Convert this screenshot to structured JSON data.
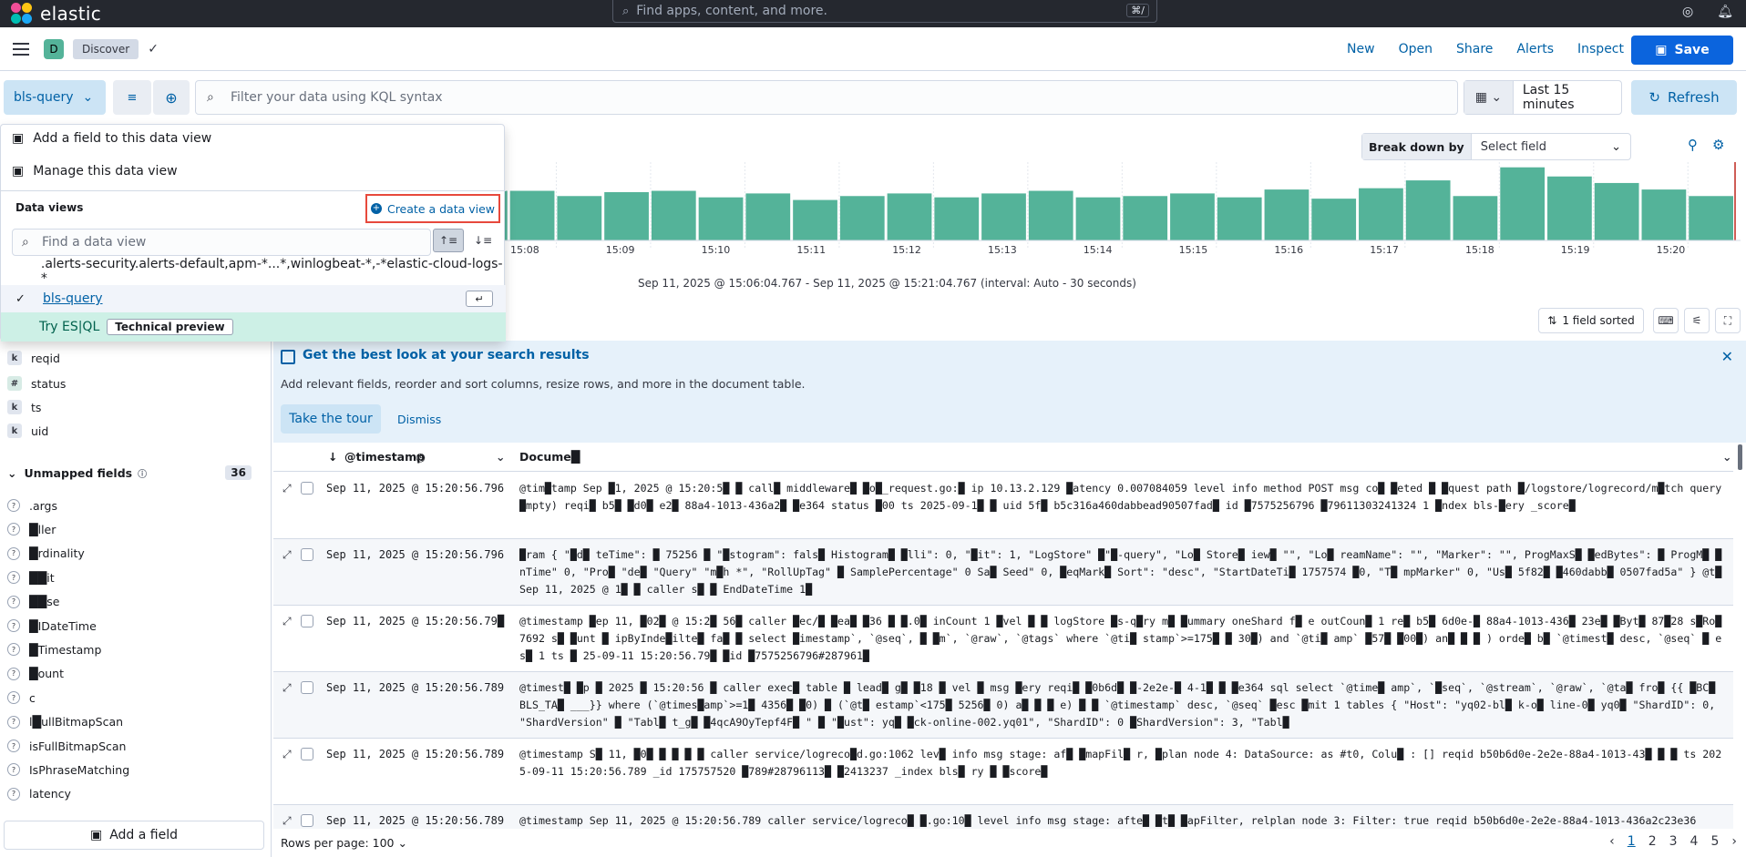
{
  "header": {
    "brand": "elastic",
    "search_placeholder": "Find apps, content, and more.",
    "search_shortcut": "⌘/",
    "icons": [
      "help-icon",
      "notifications-icon"
    ]
  },
  "app_bar": {
    "space_initial": "D",
    "breadcrumb": "Discover",
    "menu": [
      "New",
      "Open",
      "Share",
      "Alerts",
      "Inspect"
    ],
    "save_label": "Save"
  },
  "query": {
    "data_view": "bls-query",
    "placeholder": "Filter your data using KQL syntax",
    "time_range": "Last 15 minutes",
    "refresh_label": "Refresh"
  },
  "dropdown": {
    "add_field": "Add a field to this data view",
    "manage": "Manage this data view",
    "section_title": "Data views",
    "create_label": "Create a data view",
    "search_placeholder": "Find a data view",
    "options": [
      ".alerts-security.alerts-default,apm-*...*,winlogbeat-*,-*elastic-cloud-logs-*",
      "bls-query"
    ],
    "esql_label": "Try ES|QL",
    "esql_badge": "Technical preview"
  },
  "chart": {
    "breakdown_label": "Break down by",
    "breakdown_placeholder": "Select field",
    "range_text": "Sep 11, 2025 @ 15:06:04.767 - Sep 11, 2025 @ 15:21:04.767 (interval: Auto - 30 seconds)",
    "accent": "#54b399"
  },
  "chart_data": {
    "type": "bar",
    "title": "",
    "xlabel": "",
    "ylabel": "",
    "tick_labels": [
      "15:08",
      "15:09",
      "15:10",
      "15:11",
      "15:12",
      "15:13",
      "15:14",
      "15:15",
      "15:16",
      "15:17",
      "15:18",
      "15:19",
      "15:20"
    ],
    "values": [
      29,
      38,
      37,
      39,
      38,
      38,
      34,
      37,
      38,
      33,
      36,
      31,
      34,
      36,
      33,
      36,
      38,
      33,
      34,
      36,
      33,
      39,
      32,
      40,
      46,
      34,
      56,
      49,
      44,
      39,
      34
    ]
  },
  "toolbar": {
    "sorted_label": "1 field sorted"
  },
  "sidebar": {
    "fields": [
      {
        "type": "k",
        "name": "reqid"
      },
      {
        "type": "#",
        "name": "status"
      },
      {
        "type": "k",
        "name": "ts"
      },
      {
        "type": "k",
        "name": "uid"
      }
    ],
    "unmapped_title": "Unmapped fields",
    "unmapped_count": "36",
    "unmapped": [
      ".args",
      "█ller",
      "█rdinality",
      "██it",
      "██se",
      "█IDateTime",
      "█Timestamp",
      "█ount",
      "c",
      "l█ullBitmapScan",
      "isFullBitmapScan",
      "IsPhraseMatching",
      "latency"
    ],
    "add_field_label": "Add a field"
  },
  "callout": {
    "title": "Get the best look at your search results",
    "body": "Add relevant fields, reorder and sort columns, resize rows, and more in the document table.",
    "tour_label": "Take the tour",
    "dismiss_label": "Dismiss"
  },
  "grid": {
    "col_timestamp": "@timestamp",
    "col_document": "Docume█",
    "rows": [
      {
        "ts": "Sep 11, 2025 @ 15:20:56.796",
        "doc": "@tim█tamp Sep █1, 2025 @ 15:20:5█ █ call█ middleware█ █o█_request.go:█ ip 10.13.2.129 █atency 0.007084059 level info method POST msg co█ █eted █ █quest path █/logstore/logrecord/m█tch query █mpty) reqi█ b5█ █d0█ e2█ 88a4-1013-436a2█ █e364 status █00 ts 2025-09-1█ █ uid 5f█ b5c316a460dabbead90507fad█ id █7575256796 █79611303241324 1 █ndex bls-█ery _score█"
      },
      {
        "ts": "Sep 11, 2025 @ 15:20:56.796",
        "doc": "█ram { \"█d█ teTime\": █ 75256 █ \"█stogram\": fals█ Histogram█ █lli\": 0, \"█it\": 1, \"LogStore\" █\"█-query\", \"Lo█ Store█ iew█ \"\", \"Lo█ reamName\": \"\", \"Marker\": \"\", ProgMaxS█ █edBytes\": █ ProgM█ █nTime\" 0, \"Pro█ \"de█ \"Query\" \"m█h *\", \"RollUpTag\" █ SamplePercentage\" 0 Sa█ Seed\" 0, █eqMark█ Sort\": \"desc\", \"StartDateTi█ 1757574 █0, \"T█ mpMarker\" 0, \"Us█ 5f82█ █460dabb█ 0507fad5a\" } @t█ Sep 11, 2025 @ 1█ █ caller s█ █ EndDateTime 1█"
      },
      {
        "ts": "Sep 11, 2025 @ 15:20:56.79█",
        "doc": "@timestamp █ep 11, █02█ @ 15:2█ 56█ caller █ec/█ █ea█ █36 █ █.0█ inCount 1 █vel █ █ logStore █s-q█ry m█ █ummary oneShard f█ e outCoun█ 1 re█ b5█ 6d0e-█ 88a4-1013-436█ 23e█ █Byt█ 87█28 s█Ro█ 7692 s█ █unt █ ipByInde█ilte█ fa█ █ select █imestamp`, `@seq`, █ █m`, `@raw`, `@tags` where `@ti█ stamp`>=175█ █ 30█) and `@ti█ amp` █57█ █00█) an█ █ █ ) orde█ b█ `@timest█ desc, `@seq` █ es█ 1 ts █ 25-09-11 15:20:56.79█ █id █7575256796#287961█"
      },
      {
        "ts": "Sep 11, 2025 @ 15:20:56.789",
        "doc": "@timest█ █p █ 2025 █ 15:20:56 █ caller exec█ table █ lead█ g█ █18 █ vel █ msg █ery reqi█ █0b6d█ █-2e2e-█ 4-1█ █ █e364 sql select `@time█ amp`, `█seq`, `@stream`, `@raw`, `@ta█ fro█ {{ █BC█ BLS_TA█ ___}} where (`@times█amp`>=1█ 4356█ █0) █ (`@t█ estamp`<175█ 5256█ 0) a█ █ █ e) █ █ `@timestamp` desc, `@seq` █esc █mit 1 tables { \"Host\": \"yq02-bl█ k-o█ line-0█ yq0█ \"ShardID\": 0, \"ShardVersion\" █ \"Tabl█ t_g█ █4qcA9OyTepf4F█ \" █ \"█ust\": yq█ █ck-online-002.yq01\", \"ShardID\": 0 █ShardVersion\": 3, \"Tabl█"
      },
      {
        "ts": "Sep 11, 2025 @ 15:20:56.789",
        "doc": "@timestamp S█ 11, █0█ █ █ █ █ caller service/logreco█d.go:1062 lev█ info msg stage: af█ █mapFil█ r, █plan node 4: DataSource: as #t0, Colu█ : [] reqid b50b6d0e-2e2e-88a4-1013-43█ █ █ ts 2025-09-11 15:20:56.789 _id 175757520 █789#28796113█ █2413237 _index bls█ ry █ █score█"
      },
      {
        "ts": "Sep 11, 2025 @ 15:20:56.789",
        "doc": "@timestamp Sep 11, 2025 @ 15:20:56.789 caller service/logreco█ █.go:10█ level info msg stage: afte█ █t█ █apFilter, relplan node 3: Filter: true reqid b50b6d0e-2e2e-88a4-1013-436a2c23e36"
      }
    ]
  },
  "footer": {
    "rows_per_page": "Rows per page: 100",
    "pages": [
      "1",
      "2",
      "3",
      "4",
      "5"
    ]
  }
}
